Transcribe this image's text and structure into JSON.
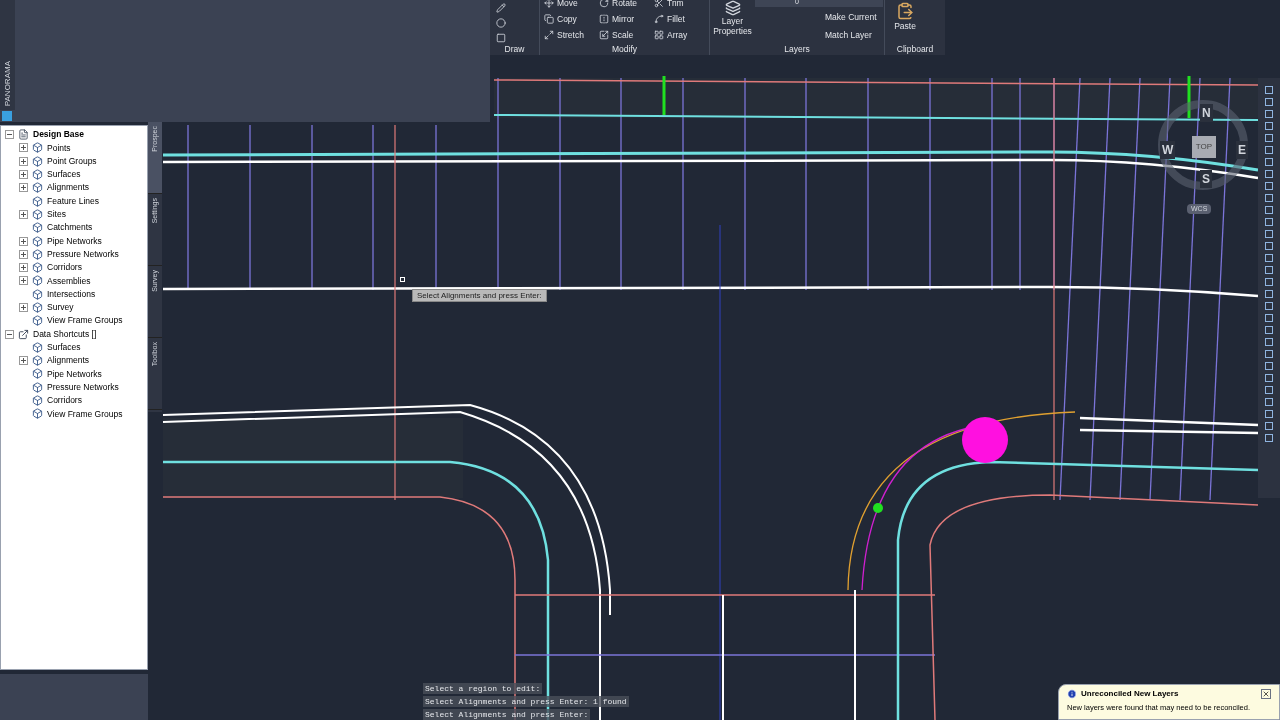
{
  "panorama_tab": {
    "label": "PANORAMA"
  },
  "ribbon": {
    "draw": {
      "title": "Draw"
    },
    "modify": {
      "title": "Modify",
      "tools": [
        {
          "label": "Move"
        },
        {
          "label": "Rotate"
        },
        {
          "label": "Trim"
        },
        {
          "label": "Copy"
        },
        {
          "label": "Mirror"
        },
        {
          "label": "Fillet"
        },
        {
          "label": "Stretch"
        },
        {
          "label": "Scale"
        },
        {
          "label": "Array"
        }
      ]
    },
    "layers": {
      "title": "Layers",
      "properties": "Layer Properties",
      "current_layer": "0",
      "make_current": "Make Current",
      "match_layer": "Match Layer"
    },
    "clipboard": {
      "title": "Clipboard",
      "paste": "Paste"
    }
  },
  "prospector": {
    "tree": [
      {
        "label": "Design Base",
        "expanded": true,
        "children": [
          {
            "label": "Points",
            "expanded": false
          },
          {
            "label": "Point Groups",
            "expanded": false
          },
          {
            "label": "Surfaces",
            "expanded": false
          },
          {
            "label": "Alignments",
            "expanded": false
          },
          {
            "label": "Feature Lines"
          },
          {
            "label": "Sites",
            "expanded": false
          },
          {
            "label": "Catchments"
          },
          {
            "label": "Pipe Networks",
            "expanded": false
          },
          {
            "label": "Pressure Networks",
            "expanded": false
          },
          {
            "label": "Corridors",
            "expanded": false
          },
          {
            "label": "Assemblies",
            "expanded": false
          },
          {
            "label": "Intersections"
          },
          {
            "label": "Survey",
            "expanded": false
          },
          {
            "label": "View Frame Groups"
          }
        ]
      },
      {
        "label": "Data Shortcuts []",
        "expanded": true,
        "children": [
          {
            "label": "Surfaces"
          },
          {
            "label": "Alignments",
            "expanded": false
          },
          {
            "label": "Pipe Networks"
          },
          {
            "label": "Pressure Networks"
          },
          {
            "label": "Corridors"
          },
          {
            "label": "View Frame Groups"
          }
        ]
      }
    ],
    "side_tabs": [
      {
        "label": "Prospec",
        "selected": true
      },
      {
        "label": "Settings",
        "selected": false
      },
      {
        "label": "Survey",
        "selected": false
      },
      {
        "label": "Toolbox",
        "selected": false
      }
    ]
  },
  "viewcube": {
    "north": "N",
    "west": "W",
    "face": "TOP",
    "east": "E",
    "south": "S",
    "ucs": "WCS"
  },
  "tooltip": "Select Alignments and press Enter:",
  "command_history": [
    "Select a region to edit:",
    "Select Alignments and press Enter: 1 found",
    "Select Alignments and press Enter:"
  ],
  "notification": {
    "title": "Unreconciled New Layers",
    "message": "New layers were found that may need to be reconciled."
  }
}
